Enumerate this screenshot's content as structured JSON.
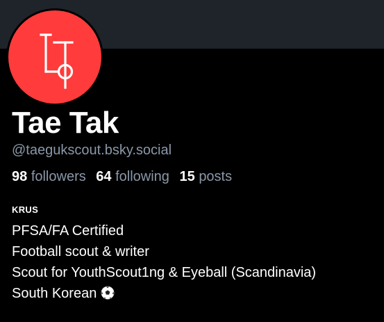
{
  "profile": {
    "display_name": "Tae Tak",
    "handle": "@taegukscout.bsky.social",
    "avatar_icon": "taegeuk-logo-icon",
    "avatar_bg": "#ff3b3b",
    "banner_color": "#1f242b"
  },
  "stats": {
    "followers_count": "98",
    "followers_label": "followers",
    "following_count": "64",
    "following_label": "following",
    "posts_count": "15",
    "posts_label": "posts"
  },
  "bio": {
    "tag": "KRUS",
    "lines": [
      "PFSA/FA Certified",
      "Football scout & writer",
      "Scout for YouthScout1ng & Eyeball (Scandinavia)",
      "South Korean"
    ],
    "emoji_icon": "soccer-ball-icon"
  },
  "colors": {
    "background": "#000000",
    "text_primary": "#ffffff",
    "text_secondary": "#8b98a8"
  }
}
